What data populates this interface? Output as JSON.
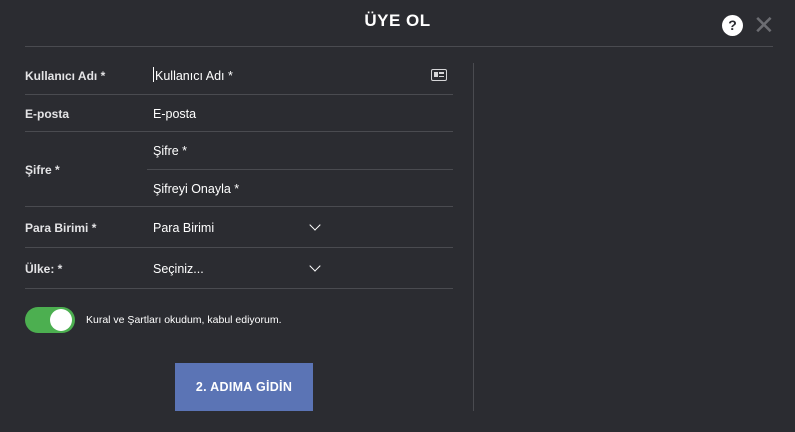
{
  "header": {
    "title": "ÜYE OL",
    "help_symbol": "?",
    "close_symbol": "✕"
  },
  "form": {
    "username": {
      "label": "Kullanıcı Adı *",
      "placeholder": "Kullanıcı Adı *",
      "icon": "id-card-icon"
    },
    "email": {
      "label": "E-posta",
      "placeholder": "E-posta"
    },
    "password": {
      "label": "Şifre *",
      "placeholder": "Şifre *",
      "confirm_placeholder": "Şifreyi Onayla *"
    },
    "currency": {
      "label": "Para Birimi *",
      "selected": "Para Birimi"
    },
    "country": {
      "label": "Ülke: *",
      "selected": "Seçiniz..."
    }
  },
  "terms": {
    "label": "Kural ve Şartları okudum, kabul ediyorum.",
    "accepted": true,
    "toggle_color": "#4caf50"
  },
  "next_button": {
    "label": "2. ADIMA GİDİN",
    "color": "#5b74b5"
  },
  "colors": {
    "background": "#2b2c31",
    "divider": "#4a4b50"
  }
}
